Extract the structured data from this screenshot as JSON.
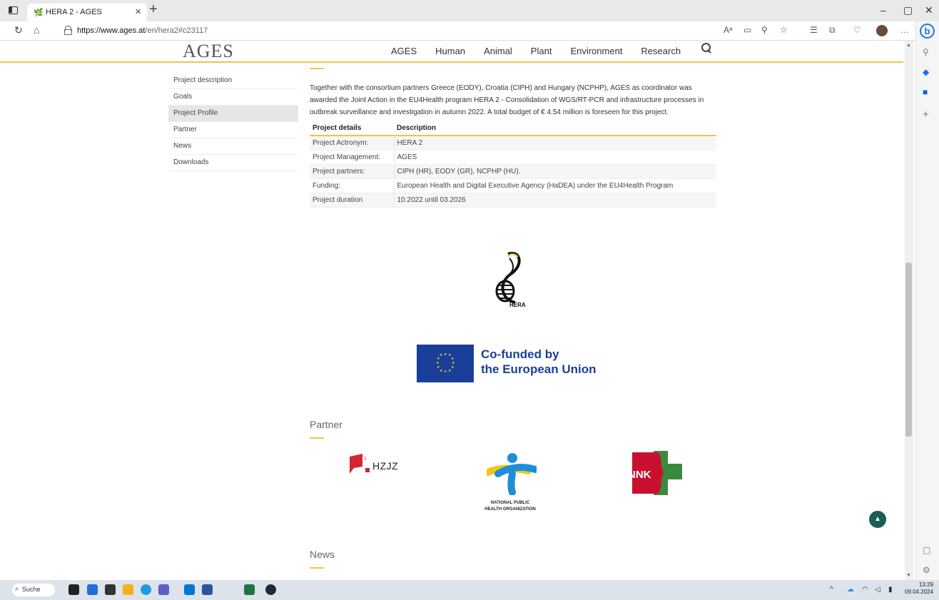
{
  "browser": {
    "tab_title": "HERA 2 - AGES",
    "url_domain": "https://www.ages.at",
    "url_path": "/en/hera2#c23117"
  },
  "site": {
    "logo": "AGES",
    "nav": [
      "AGES",
      "Human",
      "Animal",
      "Plant",
      "Environment",
      "Research"
    ]
  },
  "subnav": {
    "items": [
      "Project description",
      "Goals",
      "Project Profile",
      "Partner",
      "News",
      "Downloads"
    ],
    "active": "Project Profile"
  },
  "intro": "Together with the consortium partners Greece (EODY), Croatia (CIPH) and Hungary (NCPHP), AGES as coordinator was awarded the Joint Action in the EU4Health program HERA 2 - Consolidation of WGS/RT-PCR and infrastructure processes in outbreak surveillance and investigation in autumn 2022. A total budget of € 4.54 million is foreseen for this project.",
  "table": {
    "headers": [
      "Project details",
      "Description"
    ],
    "rows": [
      [
        "Project Actronym:",
        "HERA 2"
      ],
      [
        "Project Management:",
        "AGES"
      ],
      [
        "Project partners:",
        "CIPH (HR), EODY (GR), NCPHP (HU)."
      ],
      [
        "Funding:",
        "European Health and Digital Executive Agency (HaDEA) under the EU4Health Program"
      ],
      [
        "Project duration",
        "10.2022 until 03.2026"
      ]
    ]
  },
  "hera_logo_text": "HERA",
  "eu": {
    "line1": "Co-funded by",
    "line2": "the European Union"
  },
  "sections": {
    "partner": "Partner",
    "news": "News"
  },
  "partners": {
    "hzjz": "HZJZ",
    "nph_line1": "NATIONAL PUBLIC",
    "nph_line2": "HEALTH ORGANIZATION",
    "nnk": "NNK"
  },
  "taskbar": {
    "search": "Suche",
    "time": "13:29",
    "date": "09.04.2024"
  },
  "colors": {
    "accent": "#f0c34e",
    "eu_blue": "#1a3f9b",
    "back_top": "#1b5e57"
  }
}
